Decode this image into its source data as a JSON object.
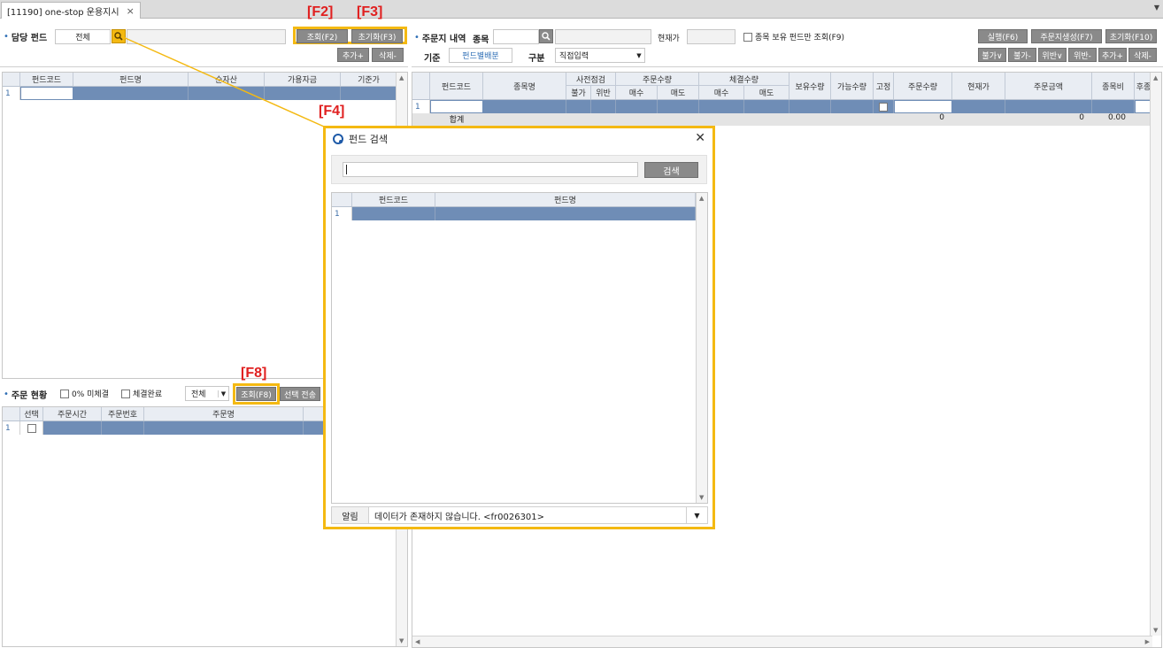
{
  "tab": {
    "title": "[11190] one-stop 운용지시",
    "close": "×",
    "dropdown": "▼"
  },
  "fkeys": {
    "f2": "[F2]",
    "f3": "[F3]",
    "f4": "[F4]",
    "f8": "[F8]"
  },
  "left": {
    "fund_label": "담당 펀드",
    "fund_value": "전체",
    "btn_query": "조회(F2)",
    "btn_reset": "초기화(F3)",
    "btn_add": "추가+",
    "btn_delete": "삭제-",
    "grid_headers": [
      "펀드코드",
      "펀드명",
      "순자산",
      "가용자금",
      "기준가"
    ],
    "row_num": "1"
  },
  "order_status": {
    "label": "주문 현황",
    "chk_unfilled": "0% 미체결",
    "chk_filled": "체결완료",
    "select_value": "전체",
    "btn_query": "조회(F8)",
    "btn_send": "선택 전송",
    "grid_headers": [
      "선택",
      "주문시간",
      "주문번호",
      "주문명"
    ],
    "row_num": "1"
  },
  "right": {
    "title": "주문지 내역",
    "item_label": "종목",
    "price_label": "현재가",
    "chk_only_held": "종목 보유 펀드만 조회(F9)",
    "btn_run": "실행(F6)",
    "btn_create": "주문지생성(F7)",
    "btn_reset": "초기화(F10)",
    "basis_label": "기준",
    "basis_value": "펀드별배분",
    "type_label": "구분",
    "type_value": "직접입력",
    "small_btns": [
      "불가∨",
      "불가-",
      "위반∨",
      "위반-",
      "추가+",
      "삭제-"
    ],
    "headers_top": {
      "fund_code": "펀드코드",
      "item_name": "종목명",
      "precheck": "사전점검",
      "order_qty": "주문수량",
      "exec_qty": "체결수량",
      "held_qty": "보유수량",
      "avail_qty": "가능수량",
      "fixed": "고정",
      "ord_qty2": "주문수량",
      "cur_price": "현재가",
      "ord_amt": "주문금액",
      "weight": "종목비",
      "after": "후종"
    },
    "headers_sub": {
      "no": "불가",
      "violation": "위반",
      "buy": "매수",
      "sell": "매도",
      "buy2": "매수",
      "sell2": "매도"
    },
    "row_num": "1",
    "total_label": "합계",
    "total_qty": "0",
    "total_amt": "0",
    "total_weight": "0.00"
  },
  "dialog": {
    "title": "펀드 검색",
    "btn_search": "검색",
    "headers": [
      "펀드코드",
      "펀드명"
    ],
    "row_num": "1",
    "status_label": "알림",
    "status_msg": "데이터가 존재하지 않습니다. <fr0026301>"
  },
  "colors": {
    "highlight": "#f4b912",
    "row_selected": "#6f8db6",
    "fkey": "#e02020"
  }
}
